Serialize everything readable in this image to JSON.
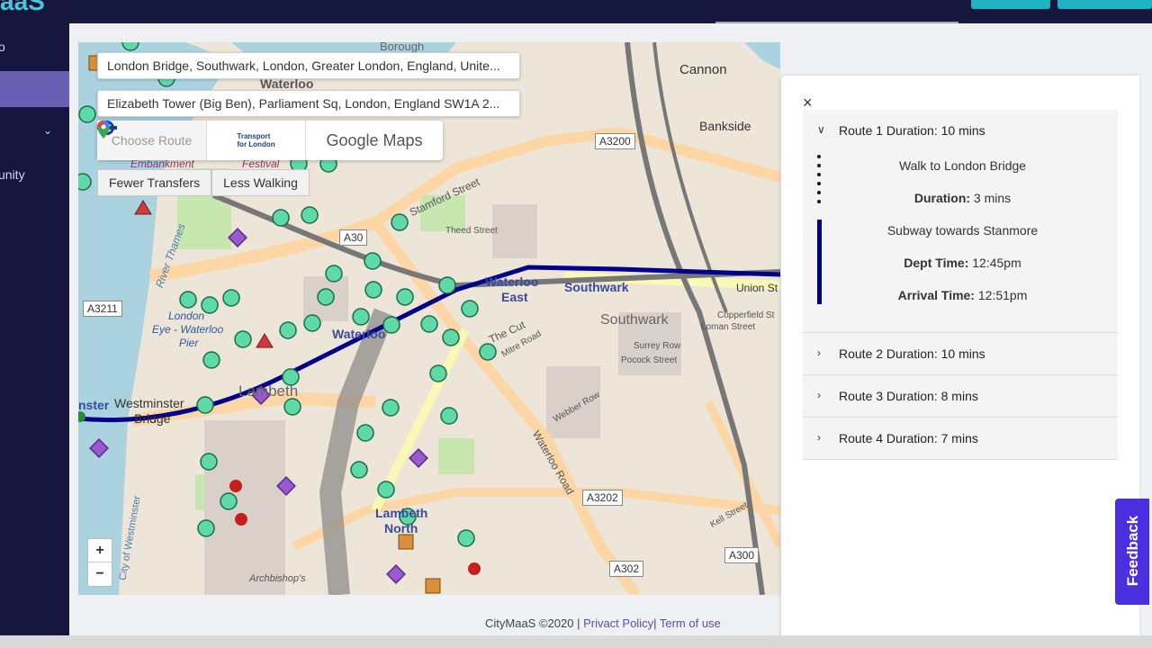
{
  "app": {
    "logo_fragment": "aaS"
  },
  "sidebar": {
    "item_top": "o",
    "item_community": "unity"
  },
  "map": {
    "origin_input": "London Bridge, Southwark, London, Greater London, England, Unite...",
    "destination_input": "Elizabeth Tower (Big Ben), Parliament Sq, London, England SW1A 2...",
    "choose_route_label": "Choose Route",
    "tfl_label_line1": "Transport",
    "tfl_label_line2": "for London",
    "google_maps_label": "Google Maps",
    "fewer_transfers_label": "Fewer Transfers",
    "less_walking_label": "Less Walking",
    "zoom_in": "+",
    "zoom_out": "−",
    "labels": {
      "waterloo": "Waterloo",
      "waterloo_east": "Waterloo",
      "waterloo_east2": "East",
      "southwark": "Southwark",
      "southwark2": "Southwark",
      "lambeth": "Lambeth",
      "lambeth_north": "Lambeth",
      "lambeth_north2": "North",
      "westminster": "Westminster",
      "bridge": "Bridge",
      "nster": "nster",
      "london_eye": "London",
      "eye2": "Eye - Waterloo",
      "pier": "Pier",
      "embankment": "Embankment",
      "festival": "Festival",
      "bankside": "Bankside",
      "cannon": "Cannon",
      "borough": "Borough",
      "stamford": "Stamford Street",
      "the_cut": "The Cut",
      "union": "Union St",
      "waterloo_road": "Waterloo Road",
      "mitre": "Mitre Road",
      "theed": "Theed Street",
      "copperfield": "Copperfield St",
      "loman": "Loman Street",
      "surrey_row": "Surrey Row",
      "pocock": "Pocock Street",
      "webber": "Webber Row",
      "kell": "Kell Street",
      "archbishops": "Archbishop's",
      "river_thames": "River Thames",
      "city_of_westminster": "City of Westminster"
    },
    "shields": {
      "a3200": "A3200",
      "a3211": "A3211",
      "a3202": "A3202",
      "a302": "A302",
      "a300": "A300",
      "a30x": "A30"
    }
  },
  "footer": {
    "copyright": "CityMaaS ©2020 | ",
    "privacy": "Privact Policy",
    "sep": "| ",
    "terms": "Term of use"
  },
  "panel": {
    "close": "×",
    "routes": [
      {
        "header": "Route 1 Duration: 10 mins"
      },
      {
        "header": "Route 2 Duration: 10 mins"
      },
      {
        "header": "Route 3 Duration: 8 mins"
      },
      {
        "header": "Route 4 Duration: 7 mins"
      }
    ],
    "route1_steps": {
      "walk": "Walk to London Bridge",
      "duration_label": "Duration:",
      "duration_value": " 3 mins",
      "subway": "Subway towards Stanmore",
      "dept_label": "Dept Time:",
      "dept_value": " 12:45pm",
      "arrival_label": "Arrival Time:",
      "arrival_value": " 12:51pm"
    }
  },
  "feedback_label": "Feedback",
  "colors": {
    "route_line": "#00008b",
    "sidebar": "#16163f",
    "accent": "#4a2fe0",
    "stop_fill": "#5fd9a8"
  }
}
